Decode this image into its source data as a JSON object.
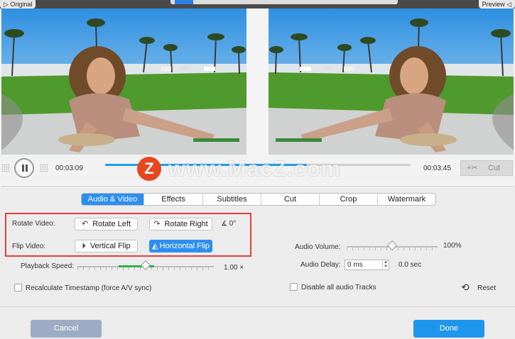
{
  "header": {
    "original_label": "Original",
    "preview_label": "Preview"
  },
  "player": {
    "current_time": "00:03:09",
    "total_time": "00:03:45",
    "progress": 0.66,
    "cut_label": "Cut"
  },
  "watermark": {
    "logo": "Z",
    "text": "www.MacZ.com"
  },
  "tabs": [
    {
      "label": "Audio & Video",
      "active": true
    },
    {
      "label": "Effects",
      "active": false
    },
    {
      "label": "Subtitles",
      "active": false
    },
    {
      "label": "Cut",
      "active": false
    },
    {
      "label": "Crop",
      "active": false
    },
    {
      "label": "Watermark",
      "active": false
    }
  ],
  "video_settings": {
    "rotate_label": "Rotate Video:",
    "rotate_left": "Rotate Left",
    "rotate_right": "Rotate Right",
    "rotation_angle": "0°",
    "flip_label": "Flip Video:",
    "vertical_flip": "Vertical Flip",
    "horizontal_flip": "Horizontal Flip",
    "playback_speed_label": "Playback Speed:",
    "playback_speed_value": "1.00 ×",
    "playback_speed_level": 0.5,
    "recalculate_label": "Recalculate Timestamp (force A/V sync)",
    "recalculate_checked": false
  },
  "audio_settings": {
    "volume_label": "Audio Volume:",
    "volume_value": "100%",
    "volume_level": 0.5,
    "delay_label": "Audio Delay:",
    "delay_value": "0 ms",
    "delay_seconds": "0.0 sec",
    "disable_tracks_label": "Disable all audio Tracks",
    "disable_tracks_checked": false,
    "reset_label": "Reset"
  },
  "footer": {
    "cancel_label": "Cancel",
    "done_label": "Done"
  },
  "colors": {
    "accent": "#2c8ff0",
    "highlight_box": "#e0403a",
    "done_button": "#1e96ee",
    "cancel_button": "#9dacc4"
  },
  "icons": {
    "rotate_left": "rotate-ccw-icon",
    "rotate_right": "rotate-cw-icon",
    "angle": "angle-icon",
    "vertical_flip": "vertical-flip-icon",
    "horizontal_flip": "horizontal-flip-icon",
    "cut": "scissors-icon",
    "reset": "reset-icon",
    "pause": "pause-icon"
  }
}
